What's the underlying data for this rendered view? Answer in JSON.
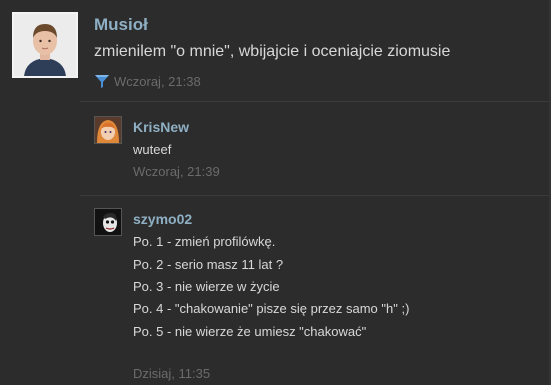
{
  "main_post": {
    "author": "Musioł",
    "text": "zmienilem \"o mnie\", wbijajcie i oceniajcie ziomusie",
    "time": "Wczoraj, 21:38",
    "icon": "funnel-icon"
  },
  "comments": [
    {
      "author": "KrisNew",
      "lines": [
        "wuteef"
      ],
      "time": "Wczoraj, 21:39"
    },
    {
      "author": "szymo02",
      "lines": [
        "Po. 1 - zmień profilówkę.",
        "Po. 2 - serio masz 11 lat ?",
        "Po. 3 - nie wierze w życie",
        "Po. 4 - \"chakowanie\" pisze się przez samo \"h\" ;)",
        "Po. 5 - nie wierze że umiesz \"chakować\""
      ],
      "time": "Dzisiaj, 11:35"
    }
  ],
  "colors": {
    "background": "#2c2c2c",
    "author_link": "#8fb0c4",
    "body_text": "#d8d8d8",
    "timestamp": "#6b6b6b",
    "icon_blue": "#4a8fd6"
  }
}
